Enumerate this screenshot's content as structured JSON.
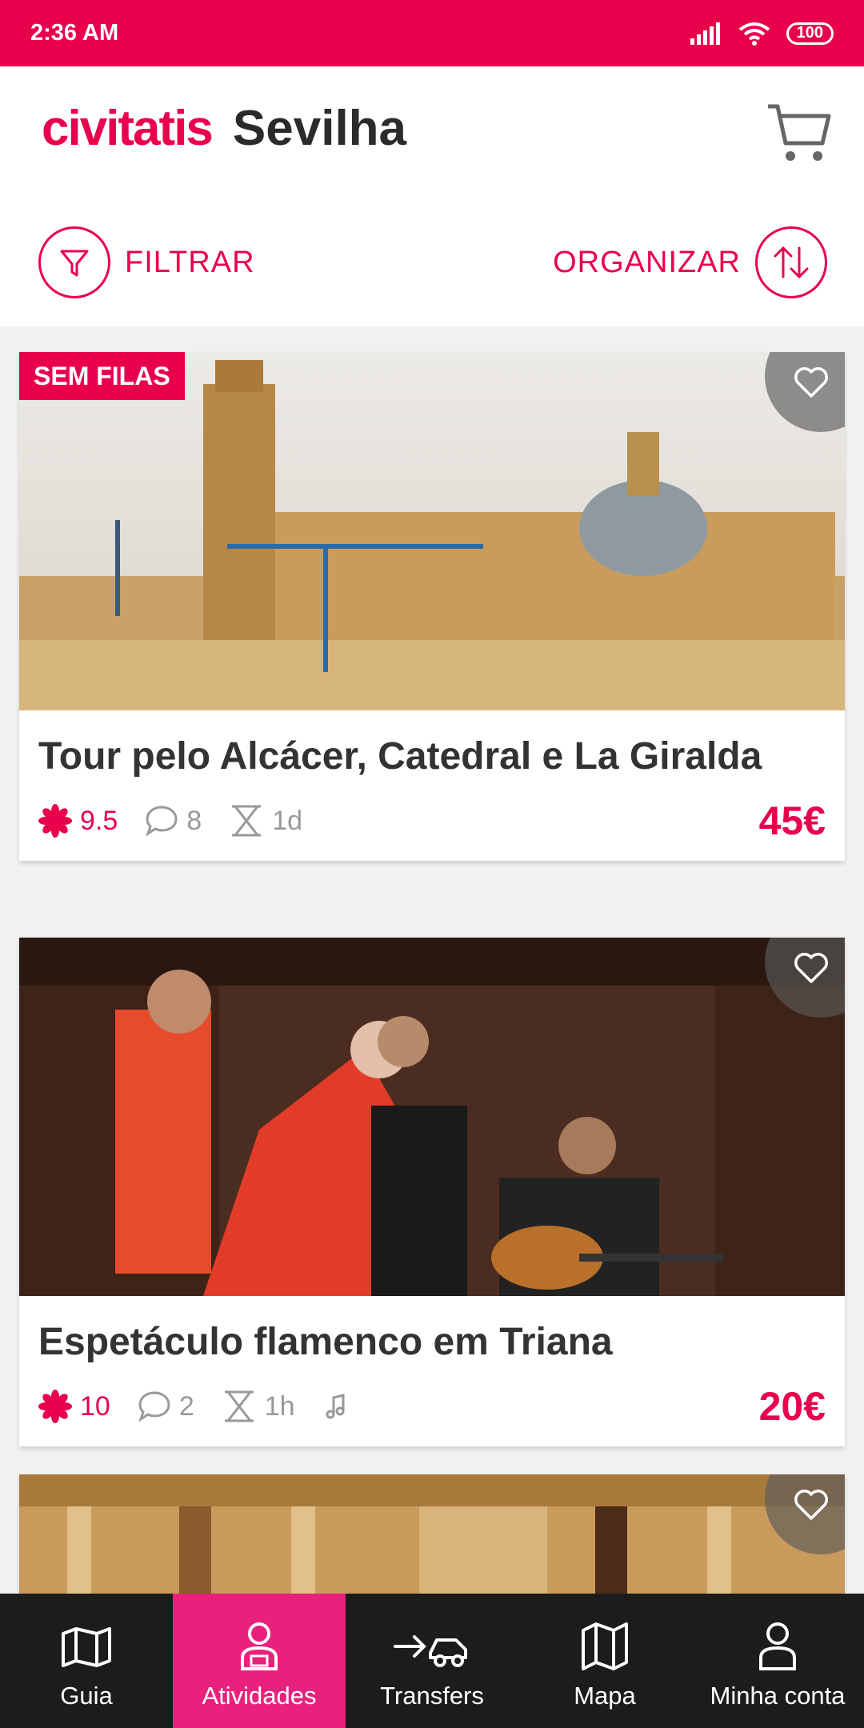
{
  "status": {
    "time": "2:36 AM",
    "battery": "100"
  },
  "header": {
    "logo": "civitatis",
    "city": "Sevilha"
  },
  "toolbar": {
    "filter_label": "FILTRAR",
    "sort_label": "ORGANIZAR"
  },
  "cards": [
    {
      "badge": "SEM FILAS",
      "title": "Tour pelo Alcácer, Catedral e La Giralda",
      "rating": "9.5",
      "comments": "8",
      "duration": "1d",
      "price": "45€"
    },
    {
      "title": "Espetáculo flamenco em Triana",
      "rating": "10",
      "comments": "2",
      "duration": "1h",
      "price": "20€"
    }
  ],
  "nav": {
    "items": [
      {
        "label": "Guia",
        "icon": "map-pin-icon"
      },
      {
        "label": "Atividades",
        "icon": "ticket-person-icon"
      },
      {
        "label": "Transfers",
        "icon": "car-arrow-icon"
      },
      {
        "label": "Mapa",
        "icon": "map-icon"
      },
      {
        "label": "Minha conta",
        "icon": "user-icon"
      }
    ],
    "active": "Atividades"
  },
  "colors": {
    "brand": "#e8004c",
    "nav_active": "#e8217d",
    "nav_bg": "#1c1c1c"
  }
}
